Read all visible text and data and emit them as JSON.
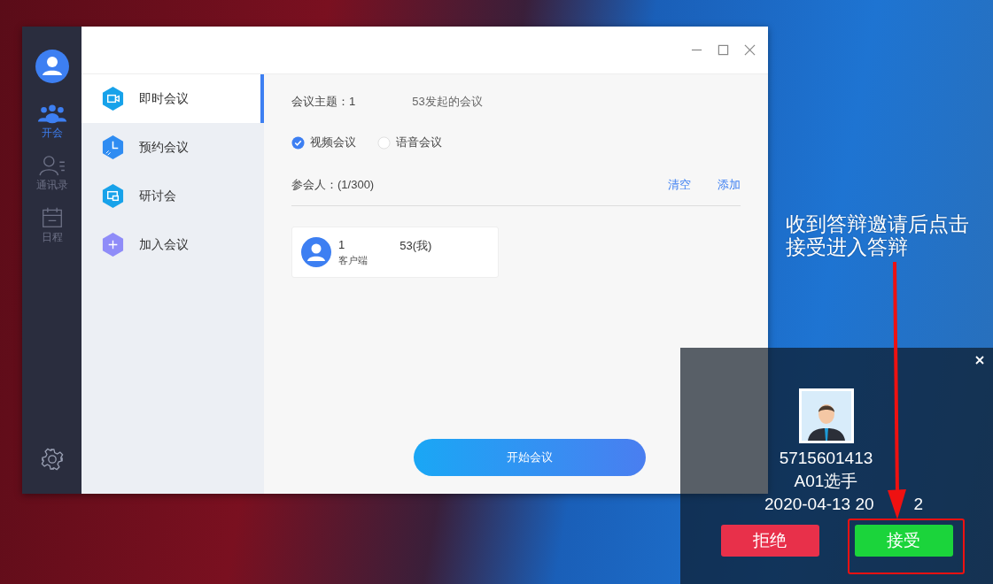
{
  "rail": {
    "items": [
      {
        "label": "开会",
        "kind": "meeting",
        "selected": true
      },
      {
        "label": "通讯录",
        "kind": "contacts",
        "selected": false
      },
      {
        "label": "日程",
        "kind": "calendar",
        "selected": false
      }
    ]
  },
  "menu": {
    "items": [
      {
        "label": "即时会议",
        "kind": "video",
        "color": "#17a2ea",
        "selected": true
      },
      {
        "label": "预约会议",
        "kind": "clock",
        "color": "#2f8cf2",
        "selected": false
      },
      {
        "label": "研讨会",
        "kind": "chat",
        "color": "#17a2ea",
        "selected": false
      },
      {
        "label": "加入会议",
        "kind": "plus",
        "color": "#8f8cf8",
        "selected": false
      }
    ]
  },
  "form": {
    "topic_label": "会议主题：1",
    "topic_suffix": "53发起的会议",
    "types": [
      {
        "label": "视频会议",
        "selected": true
      },
      {
        "label": "语音会议",
        "selected": false
      }
    ],
    "participants_label": "参会人：(1/300)",
    "actions": [
      "清空",
      "添加"
    ],
    "participants": [
      {
        "name": "1",
        "name_tail": "53(我)",
        "role": "客户端"
      }
    ],
    "start_button": "开始会议"
  },
  "annotation": {
    "lines": [
      "收到答辩邀请后点击",
      "接受进入答辩"
    ]
  },
  "invite": {
    "number": "5715601413",
    "role": "A01选手",
    "time": [
      "2020-04-13 20",
      "2"
    ],
    "buttons": [
      {
        "label": "拒绝",
        "kind": "decline"
      },
      {
        "label": "接受",
        "kind": "accept"
      }
    ]
  }
}
